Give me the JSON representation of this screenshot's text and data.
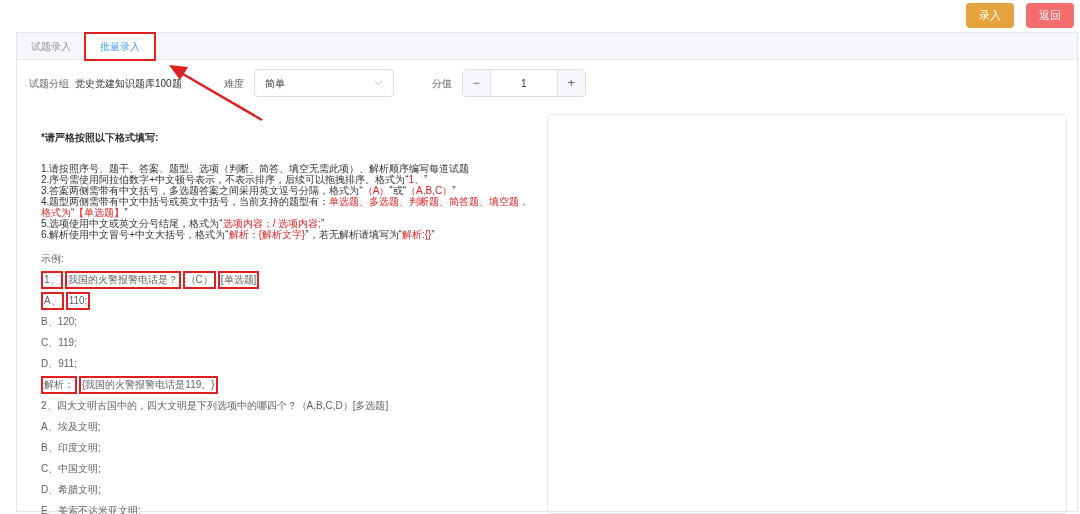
{
  "header_buttons": [
    {
      "label": "录入",
      "kind": "primary"
    },
    {
      "label": "返回",
      "kind": "danger"
    }
  ],
  "tabs": [
    {
      "label": "试题录入",
      "selected": false,
      "annotated": false
    },
    {
      "label": "批量录入",
      "selected": true,
      "annotated": true
    }
  ],
  "form": {
    "group_label": "试题分组",
    "group_value": "党史党建知识题库100题",
    "difficulty_label": "难度",
    "difficulty_value": "简单",
    "score_label": "分值",
    "score_minus": "−",
    "score_value": "1",
    "score_plus": "+"
  },
  "instructions": {
    "title": "*请严格按照以下格式填写:",
    "rules": [
      [
        {
          "text": "1.请按照序号、题干、答案、题型、选项（判断、简答、填空无需此项）、解析顺序编写每道试题",
          "red": false
        }
      ],
      [
        {
          "text": "2.序号需使用阿拉伯数字+中文顿号表示，不表示排序，后续可以拖拽排序。格式为“",
          "red": false
        },
        {
          "text": "1、",
          "red": true
        },
        {
          "text": "”",
          "red": false
        }
      ],
      [
        {
          "text": "3.答案两侧需带有中文括号，多选题答案之间采用英文逗号分隔，格式为“",
          "red": false
        },
        {
          "text": "（A）",
          "red": true
        },
        {
          "text": "”或“",
          "red": false
        },
        {
          "text": "（A,B,C）",
          "red": true
        },
        {
          "text": "”",
          "red": false
        }
      ],
      [
        {
          "text": "4.题型两侧需带有中文中括号或英文中括号，当前支持的题型有：",
          "red": false
        },
        {
          "text": "单选题、多选题、判断题、简答题、填空题，格式为",
          "red": true
        },
        {
          "text": "“",
          "red": false
        },
        {
          "text": "【单选题】",
          "red": true
        },
        {
          "text": "”",
          "red": false
        }
      ],
      [
        {
          "text": "5.选项使用中文或英文分号结尾，格式为“",
          "red": false
        },
        {
          "text": "选项内容；/ 选项内容;",
          "red": true
        },
        {
          "text": "”",
          "red": false
        }
      ],
      [
        {
          "text": "6.解析使用中文冒号+中文大括号，格式为“",
          "red": false
        },
        {
          "text": "解析：{解析文字}",
          "red": true
        },
        {
          "text": "”，若无解析请填写为“",
          "red": false
        },
        {
          "text": "解析:{}",
          "red": true
        },
        {
          "text": "”",
          "red": false
        }
      ]
    ]
  },
  "example_label": "示例:",
  "example_lines": [
    [
      {
        "text": "1、",
        "boxed": true
      },
      {
        "text": "我国的火警报警电话是？",
        "boxed": true
      },
      {
        "text": "（C）",
        "boxed": true
      },
      {
        "text": "[单选题]",
        "boxed": true
      }
    ],
    [
      {
        "text": "A、",
        "boxed": true
      },
      {
        "text": "110;",
        "boxed": true
      }
    ],
    [
      {
        "text": "B、120;",
        "boxed": false
      }
    ],
    [
      {
        "text": "C、119;",
        "boxed": false
      }
    ],
    [
      {
        "text": "D、911;",
        "boxed": false
      }
    ],
    [
      {
        "text": "解析：",
        "boxed": true
      },
      {
        "text": "{我国的火警报警电话是119。}",
        "boxed": true
      }
    ],
    [
      {
        "text": "2、四大文明古国中的，四大文明是下列选项中的哪四个？（A,B,C,D）[多选题]",
        "boxed": false
      }
    ],
    [
      {
        "text": "A、埃及文明;",
        "boxed": false
      }
    ],
    [
      {
        "text": "B、印度文明;",
        "boxed": false
      }
    ],
    [
      {
        "text": "C、中国文明;",
        "boxed": false
      }
    ],
    [
      {
        "text": "D、希腊文明;",
        "boxed": false
      }
    ],
    [
      {
        "text": "E、美索不达米亚文明;",
        "boxed": false
      }
    ]
  ]
}
